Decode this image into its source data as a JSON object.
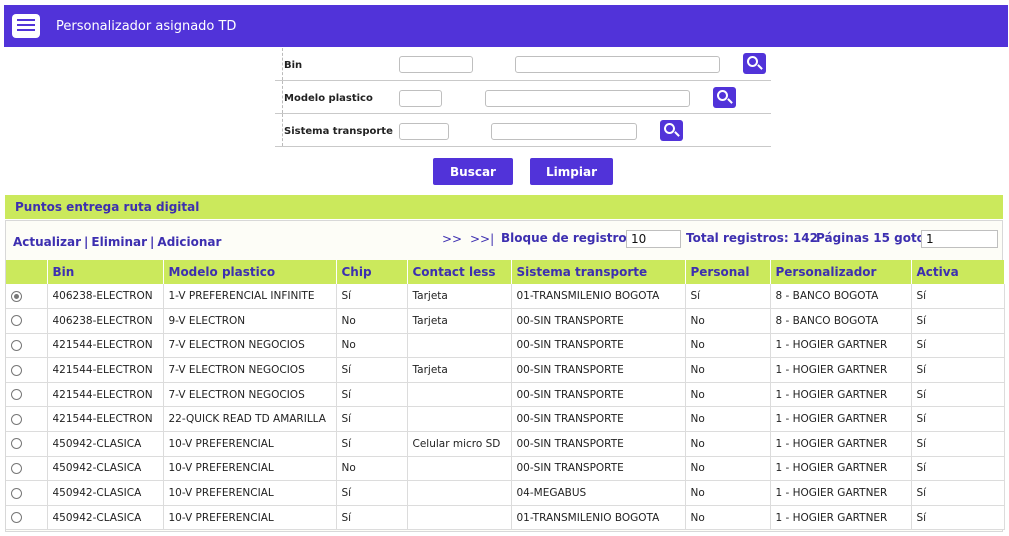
{
  "app": {
    "title": "Personalizador asignado TD",
    "icon": "list-window-icon"
  },
  "filters": [
    {
      "label": "Bin",
      "code_value": "",
      "desc_value": ""
    },
    {
      "label": "Modelo plastico",
      "code_value": "",
      "desc_value": ""
    },
    {
      "label": "Sistema transporte",
      "code_value": "",
      "desc_value": ""
    }
  ],
  "actions": {
    "buscar": "Buscar",
    "limpiar": "Limpiar"
  },
  "section": {
    "title": "Puntos entrega ruta digital"
  },
  "toolbar": {
    "actualizar": "Actualizar",
    "eliminar": "Eliminar",
    "adicionar": "Adicionar",
    "separator": "|"
  },
  "pager": {
    "next": ">>",
    "last": ">>|",
    "block_label": "Bloque de registros:",
    "block_value": "10",
    "total_label": "Total registros: 142",
    "pages_label": "Páginas 15 goto:",
    "goto_value": "1"
  },
  "table": {
    "columns": [
      "",
      "Bin",
      "Modelo plastico",
      "Chip",
      "Contact less",
      "Sistema transporte",
      "Personal",
      "Personalizador",
      "Activa"
    ],
    "rows": [
      {
        "selected": true,
        "bin": "406238-ELECTRON",
        "modelo": "1-V PREFERENCIAL INFINITE",
        "chip": "Sí",
        "contact": "Tarjeta",
        "sistema": "01-TRANSMILENIO BOGOTA",
        "personal": "Sí",
        "personalizador": "8 - BANCO BOGOTA",
        "activa": "Sí"
      },
      {
        "selected": false,
        "bin": "406238-ELECTRON",
        "modelo": "9-V ELECTRON",
        "chip": "No",
        "contact": "Tarjeta",
        "sistema": "00-SIN TRANSPORTE",
        "personal": "No",
        "personalizador": "8 - BANCO BOGOTA",
        "activa": "Sí"
      },
      {
        "selected": false,
        "bin": "421544-ELECTRON",
        "modelo": "7-V ELECTRON NEGOCIOS",
        "chip": "No",
        "contact": "",
        "sistema": "00-SIN TRANSPORTE",
        "personal": "No",
        "personalizador": "1 - HOGIER GARTNER",
        "activa": "Sí"
      },
      {
        "selected": false,
        "bin": "421544-ELECTRON",
        "modelo": "7-V ELECTRON NEGOCIOS",
        "chip": "Sí",
        "contact": "Tarjeta",
        "sistema": "00-SIN TRANSPORTE",
        "personal": "No",
        "personalizador": "1 - HOGIER GARTNER",
        "activa": "Sí"
      },
      {
        "selected": false,
        "bin": "421544-ELECTRON",
        "modelo": "7-V ELECTRON NEGOCIOS",
        "chip": "Sí",
        "contact": "",
        "sistema": "00-SIN TRANSPORTE",
        "personal": "No",
        "personalizador": "1 - HOGIER GARTNER",
        "activa": "Sí"
      },
      {
        "selected": false,
        "bin": "421544-ELECTRON",
        "modelo": "22-QUICK READ TD AMARILLA",
        "chip": "Sí",
        "contact": "",
        "sistema": "00-SIN TRANSPORTE",
        "personal": "No",
        "personalizador": "1 - HOGIER GARTNER",
        "activa": "Sí"
      },
      {
        "selected": false,
        "bin": "450942-CLASICA",
        "modelo": "10-V PREFERENCIAL",
        "chip": "Sí",
        "contact": "Celular micro SD",
        "sistema": "00-SIN TRANSPORTE",
        "personal": "No",
        "personalizador": "1 - HOGIER GARTNER",
        "activa": "Sí"
      },
      {
        "selected": false,
        "bin": "450942-CLASICA",
        "modelo": "10-V PREFERENCIAL",
        "chip": "No",
        "contact": "",
        "sistema": "00-SIN TRANSPORTE",
        "personal": "No",
        "personalizador": "1 - HOGIER GARTNER",
        "activa": "Sí"
      },
      {
        "selected": false,
        "bin": "450942-CLASICA",
        "modelo": "10-V PREFERENCIAL",
        "chip": "Sí",
        "contact": "",
        "sistema": "04-MEGABUS",
        "personal": "No",
        "personalizador": "1 - HOGIER GARTNER",
        "activa": "Sí"
      },
      {
        "selected": false,
        "bin": "450942-CLASICA",
        "modelo": "10-V PREFERENCIAL",
        "chip": "Sí",
        "contact": "",
        "sistema": "01-TRANSMILENIO BOGOTA",
        "personal": "No",
        "personalizador": "1 - HOGIER GARTNER",
        "activa": "Sí"
      }
    ]
  },
  "colors": {
    "brand": "#5133d9",
    "section_bg": "#cbe95c",
    "link": "#3d2fb0"
  }
}
